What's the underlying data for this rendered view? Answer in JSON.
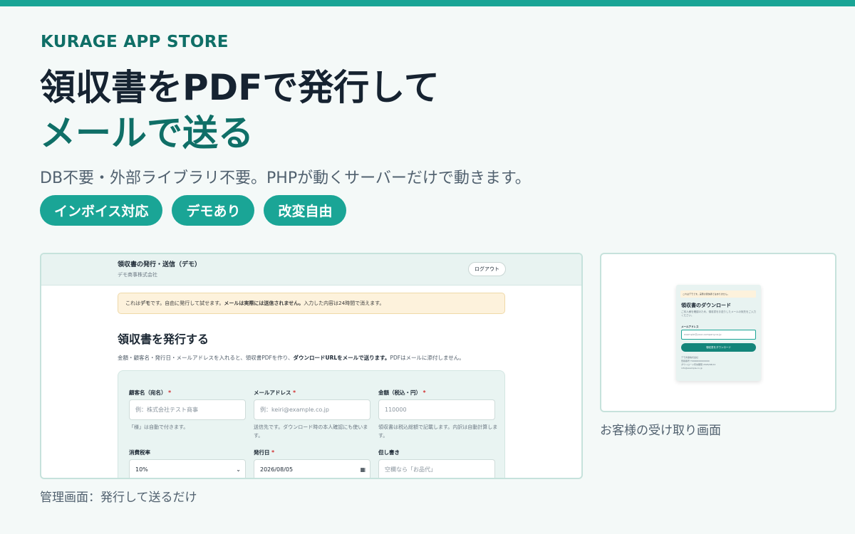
{
  "brand": "KURAGE APP STORE",
  "hero": {
    "line1": "領収書をPDFで発行して",
    "line2": "メールで送る"
  },
  "subtitle": "DB不要・外部ライブラリ不要。PHPが動くサーバーだけで動きます。",
  "badges": [
    "インボイス対応",
    "デモあり",
    "改変自由"
  ],
  "colors": {
    "accent": "#1aa596",
    "accent_dark": "#0f6f67",
    "heading": "#162331",
    "notice_bg": "#fdf2dc",
    "required": "#d12b2b"
  },
  "admin": {
    "caption": "管理画面：発行して送るだけ",
    "title": "領収書の発行・送信（デモ）",
    "company": "デモ商事株式会社",
    "logout_label": "ログアウト",
    "notice": {
      "part1": "これは",
      "bold1": "デモ",
      "part2": "です。自由に発行して試せます。",
      "bold2": "メールは実際には送信されません。",
      "part3": "入力した内容は24時間で消えます。"
    },
    "heading": "領収書を発行する",
    "description": {
      "part1": "金額・顧客名・発行日・メールアドレスを入れると、領収書PDFを作り、",
      "bold": "ダウンロードURLをメールで送ります。",
      "part2": "PDFはメールに添付しません。"
    },
    "form": {
      "customer_label": "顧客名（宛名）",
      "customer_placeholder": "例：株式会社テスト商事",
      "customer_help": "「様」は自動で付きます。",
      "email_label": "メールアドレス",
      "email_placeholder": "例：keiri@example.co.jp",
      "email_help": "送信先です。ダウンロード時の本人確認にも使います。",
      "amount_label": "金額（税込・円）",
      "amount_placeholder": "110000",
      "amount_help": "領収書は税込総額で記載します。内訳は自動計算します。",
      "tax_label": "消費税率",
      "tax_value": "10%",
      "date_label": "発行日",
      "date_value": "2026/08/05",
      "note_label": "但し書き",
      "note_placeholder": "空欄なら「お品代」",
      "required_mark": "*"
    }
  },
  "customer": {
    "caption": "お客様の受け取り画面",
    "notice": "これはデモです。実際の受信者ではありません。",
    "title": "領収書のダウンロード",
    "description": "ご本人様を確認のため、領収書をお送りしたメールの宛先をご入力ください。",
    "email_label": "メールアドレス",
    "email_placeholder": "example@your-company.co.jp",
    "button_label": "領収書をダウンロード",
    "footer_lines": [
      "デモ商事株式会社",
      "登録番号 T0000000000000",
      "ダウンロード有効期限 2026/08/12",
      "info@example.co.jp"
    ]
  }
}
